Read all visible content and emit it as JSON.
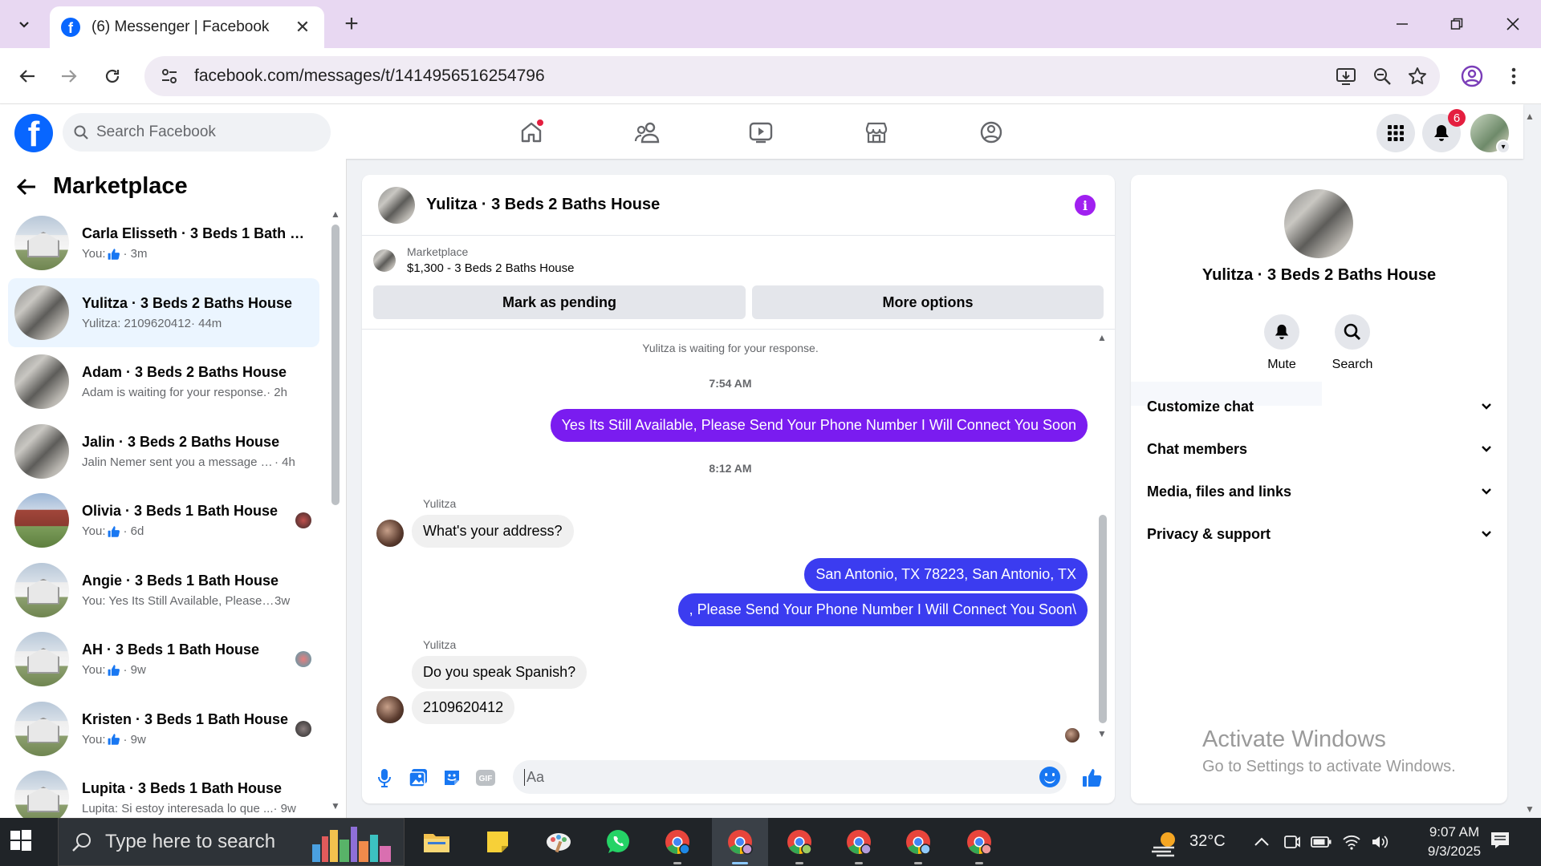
{
  "browser": {
    "tab_title": "(6) Messenger | Facebook",
    "url": "facebook.com/messages/t/1414956516254796"
  },
  "fb_header": {
    "search_placeholder": "Search Facebook",
    "notification_count": "6",
    "brand_color": "#0866ff"
  },
  "sidebar": {
    "title": "Marketplace",
    "conversations": [
      {
        "name": "Carla Elisseth · 3 Beds 1 Bath Ho...",
        "you": "You:",
        "liked": true,
        "preview": "",
        "time": "· 3m",
        "thumb": "white-house",
        "read_avatar": false
      },
      {
        "name": "Yulitza · 3 Beds 2 Baths House",
        "you": "",
        "liked": false,
        "preview": "Yulitza: 2109620412",
        "time": "· 44m",
        "thumb": "kitchen",
        "read_avatar": false,
        "active": true
      },
      {
        "name": "Adam · 3 Beds 2 Baths House",
        "you": "",
        "liked": false,
        "preview": "Adam is waiting for your response.",
        "time": "· 2h",
        "thumb": "kitchen",
        "read_avatar": false
      },
      {
        "name": "Jalin · 3 Beds 2 Baths House",
        "you": "",
        "liked": false,
        "preview": "Jalin Nemer sent you a message a...",
        "time": "· 4h",
        "thumb": "kitchen",
        "read_avatar": false
      },
      {
        "name": "Olivia · 3 Beds 1 Bath House",
        "you": "You:",
        "liked": true,
        "preview": "",
        "time": "· 6d",
        "thumb": "red-house",
        "read_avatar": true
      },
      {
        "name": "Angie · 3 Beds 1 Bath House",
        "you": "",
        "liked": false,
        "preview": "You: Yes Its Still Available, Please S...",
        "time": "3w",
        "thumb": "white-house",
        "read_avatar": false
      },
      {
        "name": "AH · 3 Beds 1 Bath House",
        "you": "You:",
        "liked": true,
        "preview": "",
        "time": "· 9w",
        "thumb": "white-house",
        "read_avatar": true
      },
      {
        "name": "Kristen · 3 Beds 1 Bath House",
        "you": "You:",
        "liked": true,
        "preview": "",
        "time": "· 9w",
        "thumb": "white-house",
        "read_avatar": true
      },
      {
        "name": "Lupita · 3 Beds 1 Bath House",
        "you": "",
        "liked": false,
        "preview": "Lupita: Si estoy interesada lo que ...",
        "time": "· 9w",
        "thumb": "white-house",
        "read_avatar": false
      }
    ]
  },
  "chat": {
    "title": "Yulitza · 3 Beds 2 Baths House",
    "listing_category": "Marketplace",
    "listing_title": "$1,300 - 3 Beds 2 Baths House",
    "mark_pending_label": "Mark as pending",
    "more_options_label": "More options",
    "waiting_note": "Yulitza is waiting for your response.",
    "time_1": "7:54 AM",
    "time_2": "8:12 AM",
    "msg_out_1": "Yes Its Still Available, Please Send Your Phone Number I Will Connect You Soon",
    "sender_1": "Yulitza",
    "msg_in_1": "What's your address?",
    "msg_out_2": "San Antonio, TX 78223, San Antonio, TX",
    "msg_out_3": ", Please Send Your Phone Number I Will Connect You Soon\\",
    "sender_2": "Yulitza",
    "msg_in_2": "Do you speak Spanish?",
    "msg_in_3": "2109620412",
    "composer_placeholder": "Aa",
    "outgoing_color": "#7a1cf0",
    "outgoing_color_2": "#3b3cf0"
  },
  "info_panel": {
    "name": "Yulitza · 3 Beds 2 Baths House",
    "mute_label": "Mute",
    "search_label": "Search",
    "rows": [
      "Customize chat",
      "Chat members",
      "Media, files and links",
      "Privacy & support"
    ]
  },
  "watermark": {
    "line1": "Activate Windows",
    "line2": "Go to Settings to activate Windows."
  },
  "taskbar": {
    "search_placeholder": "Type here to search",
    "temperature": "32°C",
    "time": "9:07 AM",
    "date": "9/3/2025"
  }
}
